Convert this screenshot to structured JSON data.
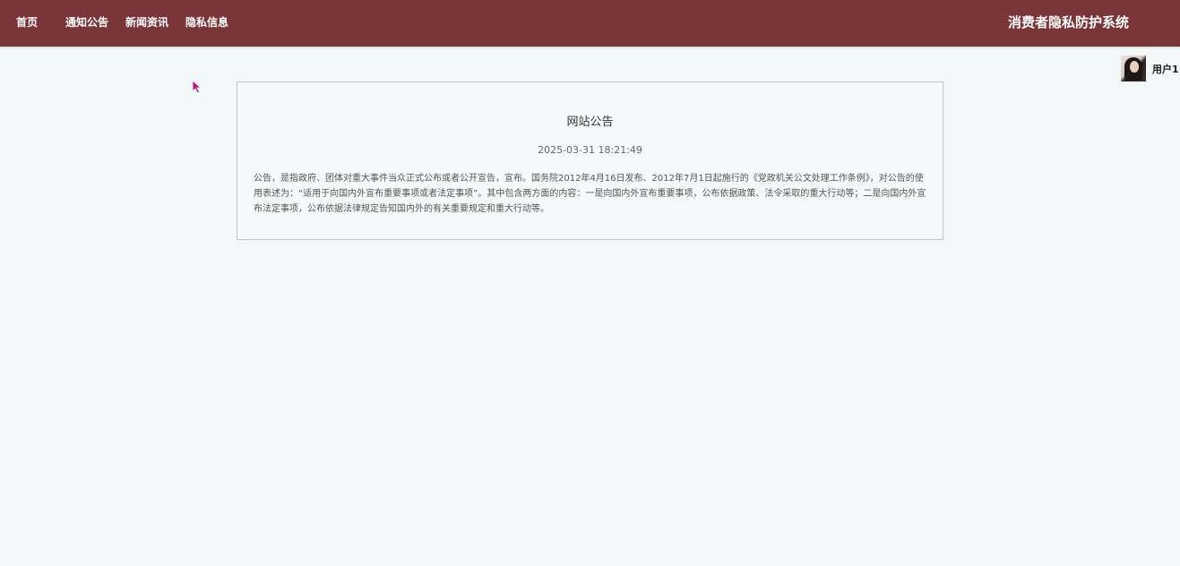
{
  "nav": {
    "items": [
      {
        "label": "首页"
      },
      {
        "label": "通知公告"
      },
      {
        "label": "新闻资讯"
      },
      {
        "label": "隐私信息"
      }
    ]
  },
  "header": {
    "site_title": "消费者隐私防护系统"
  },
  "user": {
    "name": "用户1"
  },
  "notice": {
    "title": "网站公告",
    "datetime": "2025-03-31 18:21:49",
    "content": "公告，是指政府、团体对重大事件当众正式公布或者公开宣告，宣布。国务院2012年4月16日发布、2012年7月1日起施行的《党政机关公文处理工作条例》，对公告的使用表述为：“适用于向国内外宣布重要事项或者法定事项”。其中包含两方面的内容：一是向国内外宣布重要事项，公布依据政策、法令采取的重大行动等；二是向国内外宣布法定事项，公布依据法律规定告知国内外的有关重要规定和重大行动等。"
  },
  "colors": {
    "topbar": "#7a3538",
    "page_background": "#f2f7f7",
    "card_border": "#c4c4c4",
    "cursor": "#b0207a"
  }
}
